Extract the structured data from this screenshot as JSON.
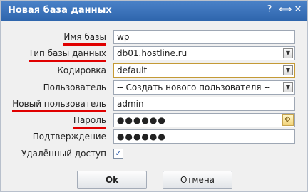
{
  "window": {
    "title": "Новая база данных"
  },
  "titlebar_tools": [
    {
      "name": "help",
      "glyph": "?"
    },
    {
      "name": "resize",
      "glyph": "⟺"
    },
    {
      "name": "close",
      "glyph": "✕"
    }
  ],
  "form": {
    "db_name_label": "Имя базы",
    "db_name_value": "wp",
    "db_type_label": "Тип базы данных",
    "db_type_value": "db01.hostline.ru",
    "encoding_label": "Кодировка",
    "encoding_value": "default",
    "user_label": "Пользователь",
    "user_value": "-- Создать нового пользователя --",
    "new_user_label": "Новый пользователь",
    "new_user_value": "admin",
    "password_label": "Пароль",
    "password_value": "●●●●●●",
    "confirm_label": "Подтверждение",
    "confirm_value": "●●●●●●",
    "remote_access_label": "Удалённый доступ",
    "remote_access_checked": "✓"
  },
  "buttons": {
    "ok": "Ok",
    "cancel": "Отмена"
  },
  "icons": {
    "dropdown": "▼",
    "password_generator": "⚙"
  },
  "colors": {
    "titlebar": "#3a74bd",
    "highlight_underline": "#e00000",
    "dialog_bg": "#f0f0f0"
  }
}
